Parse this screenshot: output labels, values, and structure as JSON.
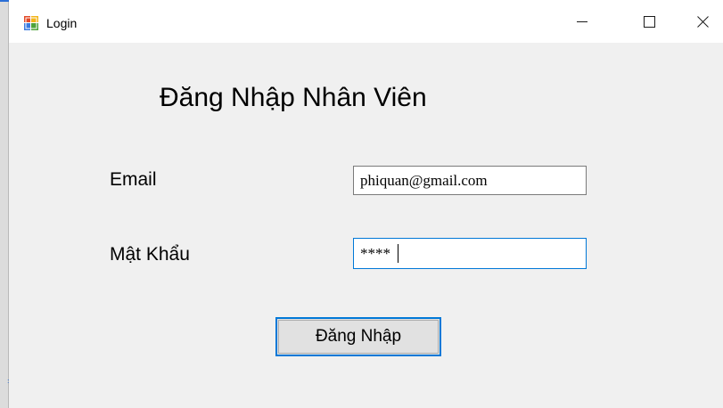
{
  "window": {
    "title": "Login",
    "icon": "winforms-app-icon",
    "controls": {
      "minimize": "minimize-icon",
      "maximize": "maximize-icon",
      "close": "close-icon"
    }
  },
  "form": {
    "heading": "Đăng Nhập Nhân Viên",
    "email_label": "Email",
    "email_value": "phiquan@gmail.com",
    "password_label": "Mật Khẩu",
    "password_value": "****",
    "submit_label": "Đăng Nhập"
  },
  "colors": {
    "client_background": "#f0f0f0",
    "focus_border": "#0078d7",
    "button_face": "#e1e1e1"
  }
}
